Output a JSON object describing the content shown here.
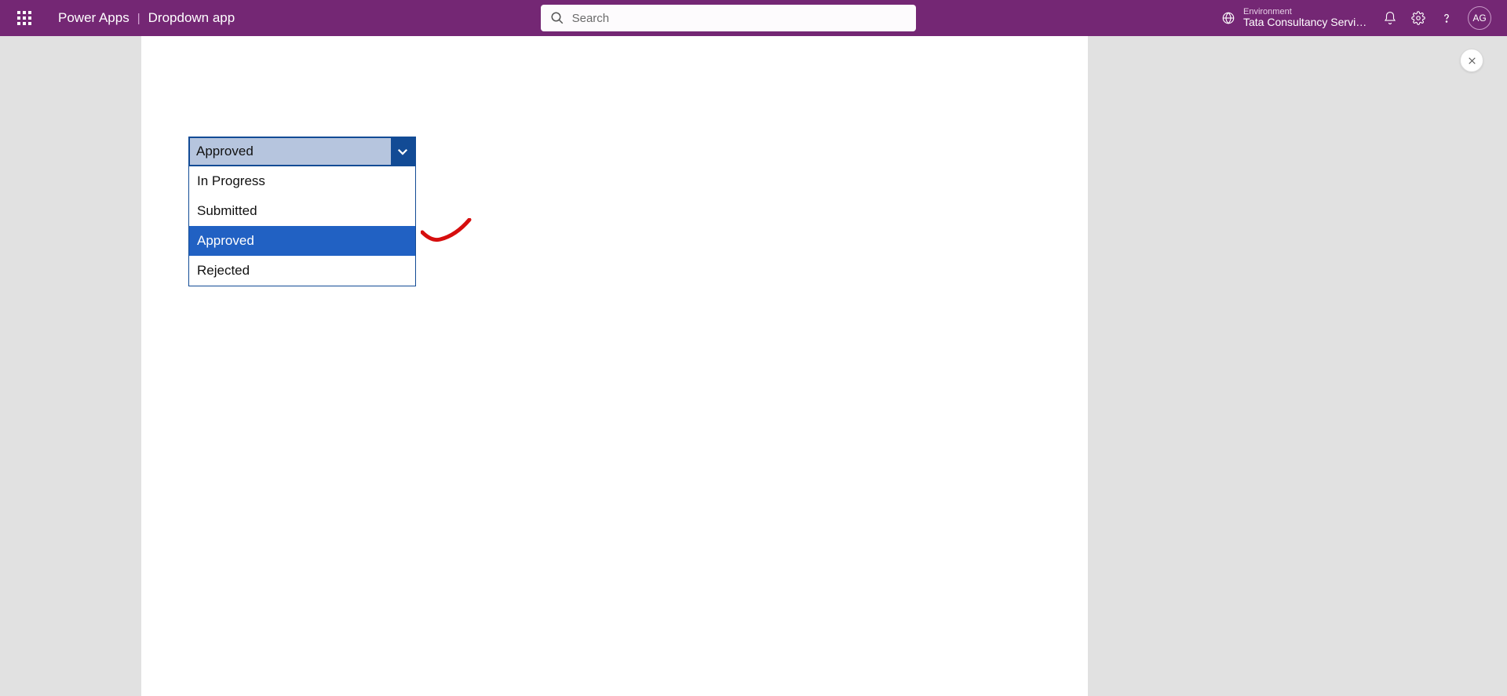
{
  "header": {
    "product": "Power Apps",
    "separator": "|",
    "app_name": "Dropdown app",
    "search_placeholder": "Search",
    "env_label": "Environment",
    "env_value": "Tata Consultancy Servic...",
    "avatar_initials": "AG"
  },
  "dropdown": {
    "selected_value": "Approved",
    "options": [
      "In Progress",
      "Submitted",
      "Approved",
      "Rejected"
    ],
    "selected_index": 2
  }
}
